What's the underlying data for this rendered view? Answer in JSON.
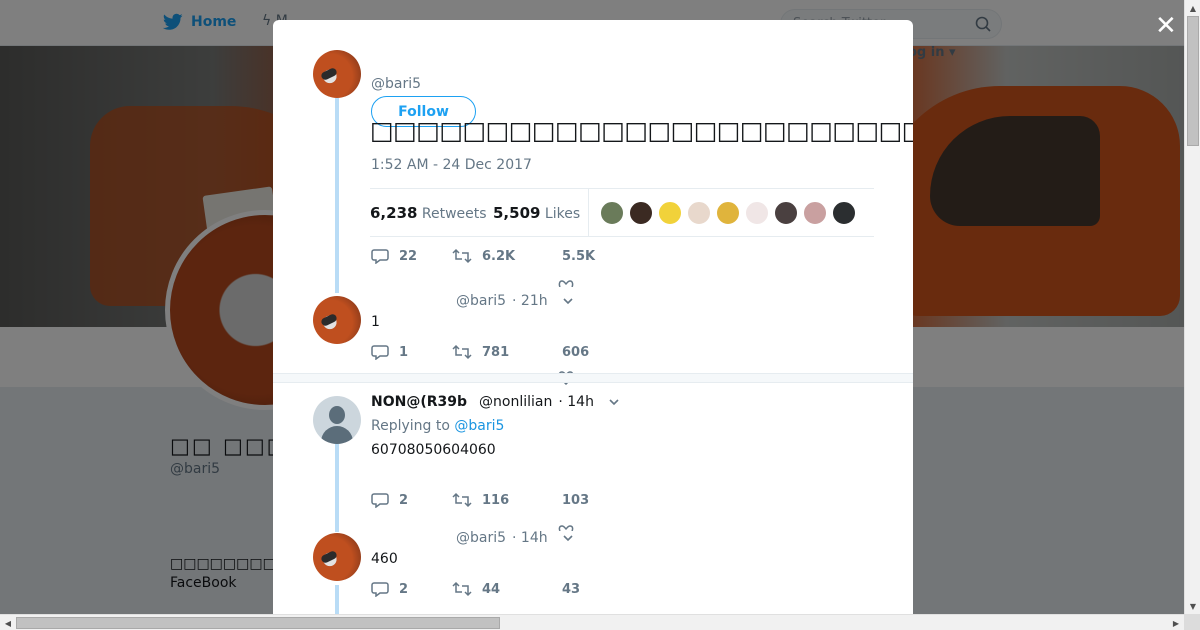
{
  "topbar": {
    "home_label": "Home",
    "moments_label": "M",
    "search_placeholder": "Search Twitter",
    "login_label": "og in"
  },
  "profile": {
    "name": "□□ □□□□□□",
    "handle": "@bari5",
    "bio_line1": "□□□□□□□□□□□□□□",
    "bio_line2": "FaceBook"
  },
  "modal": {
    "main_tweet": {
      "handle": "@bari5",
      "follow_label": "Follow",
      "text": "□□□□□□□□□□□□□□□□□□□□□□□□□□□□□□□□□□□□□□□□□□□□□□",
      "timestamp": "1:52 AM - 24 Dec 2017",
      "retweets_count": "6,238",
      "retweets_label": "Retweets",
      "likes_count": "5,509",
      "likes_label": "Likes",
      "likers_colors": [
        "#6a7b5a",
        "#3b2a22",
        "#f1d23a",
        "#e8d8cc",
        "#e0b43c",
        "#f0e6e6",
        "#4a4040",
        "#c9a0a0",
        "#2b2e30"
      ],
      "replies": "22",
      "rts": "6.2K",
      "likes": "5.5K"
    },
    "replies": [
      {
        "handle": "@bari5",
        "time": "· 21h",
        "text": "1",
        "replies": "1",
        "rts": "781",
        "likes": "606"
      },
      {
        "name": "NON@(R39b",
        "handle": "@nonlilian",
        "time": "· 14h",
        "replying_prefix": "Replying to",
        "replying_to": "@bari5",
        "text": "60708050604060",
        "replies": "2",
        "rts": "116",
        "likes": "103"
      },
      {
        "handle": "@bari5",
        "time": "· 14h",
        "text": "460",
        "replies": "2",
        "rts": "44",
        "likes": "43"
      }
    ]
  },
  "accent": "#1da1f2"
}
